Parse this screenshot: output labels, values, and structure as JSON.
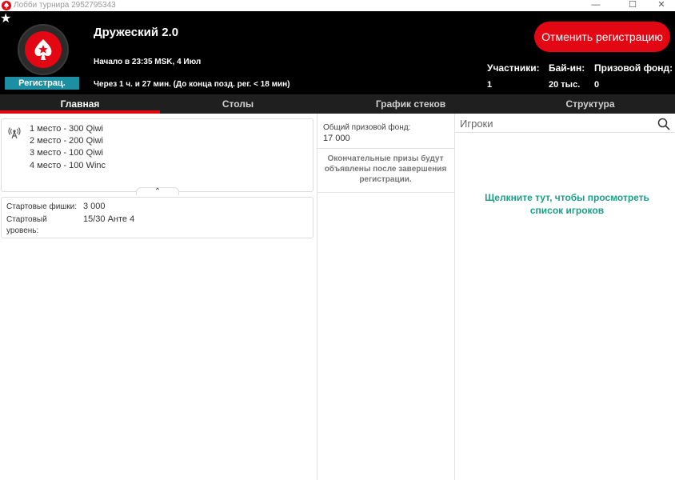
{
  "window": {
    "title": "Лобби турнира 2952795343",
    "controls": {
      "minimize": "—",
      "maximize": "☐",
      "close": "✕"
    }
  },
  "header": {
    "favorite_icon": "star-icon",
    "badge": "Регистрац.",
    "tournament_name": "Дружеский 2.0",
    "start_time": "Начало в 23:35 MSK, 4 Июл",
    "late_reg": "Через 1 ч. и 27 мин. (До конца позд. рег. < 18 мин)",
    "unregister_button": "Отменить регистрацию",
    "stats": {
      "players_label": "Участники:",
      "players_value": "1",
      "buyin_label": "Бай-ин:",
      "buyin_value": "20 тыс.",
      "prizepool_label": "Призовой фонд:",
      "prizepool_value": "0"
    }
  },
  "tabs": [
    {
      "label": "Главная",
      "active": true
    },
    {
      "label": "Столы",
      "active": false
    },
    {
      "label": "График стеков",
      "active": false
    },
    {
      "label": "Структура",
      "active": false
    }
  ],
  "payouts": [
    "1 место - 300 Qiwi",
    "2 место - 200 Qiwi",
    "3 место - 100 Qiwi",
    "4 место - 100 Winc"
  ],
  "chips": {
    "starting_chips_label": "Стартовые фишки:",
    "starting_chips_value": "3 000",
    "starting_level_label_1": "Стартовый",
    "starting_level_label_2": "уровень:",
    "starting_level_value": "15/30 Анте 4"
  },
  "prize": {
    "label": "Общий призовой фонд:",
    "value": "17 000",
    "note": "Окончательные призы будут объявлены после завершения регистрации."
  },
  "players": {
    "search_placeholder": "Игроки",
    "link": "Щелкните тут, чтобы просмотреть список игроков"
  },
  "colors": {
    "accent": "#e30613",
    "badge": "#1c8fa3",
    "link": "#1aa087",
    "header_bg": "#000000",
    "tabs_bg": "#1f1f1f"
  }
}
